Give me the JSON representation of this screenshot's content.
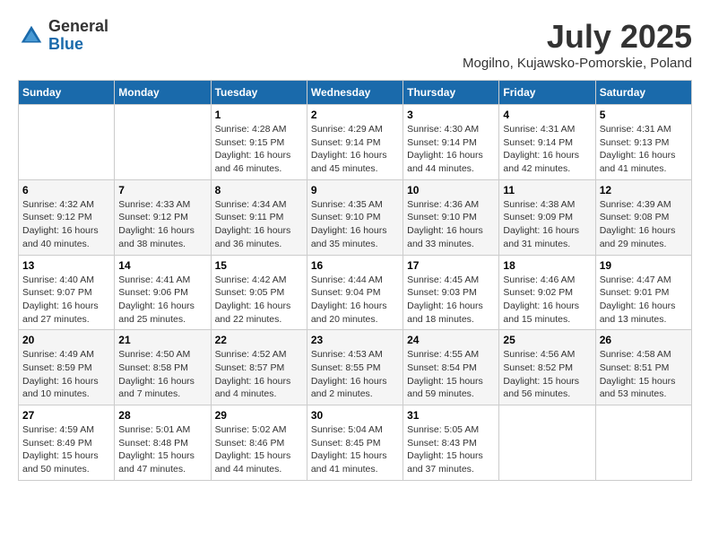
{
  "logo": {
    "general": "General",
    "blue": "Blue"
  },
  "title": "July 2025",
  "subtitle": "Mogilno, Kujawsko-Pomorskie, Poland",
  "days_of_week": [
    "Sunday",
    "Monday",
    "Tuesday",
    "Wednesday",
    "Thursday",
    "Friday",
    "Saturday"
  ],
  "weeks": [
    [
      {
        "day": "",
        "info": ""
      },
      {
        "day": "",
        "info": ""
      },
      {
        "day": "1",
        "info": "Sunrise: 4:28 AM\nSunset: 9:15 PM\nDaylight: 16 hours and 46 minutes."
      },
      {
        "day": "2",
        "info": "Sunrise: 4:29 AM\nSunset: 9:14 PM\nDaylight: 16 hours and 45 minutes."
      },
      {
        "day": "3",
        "info": "Sunrise: 4:30 AM\nSunset: 9:14 PM\nDaylight: 16 hours and 44 minutes."
      },
      {
        "day": "4",
        "info": "Sunrise: 4:31 AM\nSunset: 9:14 PM\nDaylight: 16 hours and 42 minutes."
      },
      {
        "day": "5",
        "info": "Sunrise: 4:31 AM\nSunset: 9:13 PM\nDaylight: 16 hours and 41 minutes."
      }
    ],
    [
      {
        "day": "6",
        "info": "Sunrise: 4:32 AM\nSunset: 9:12 PM\nDaylight: 16 hours and 40 minutes."
      },
      {
        "day": "7",
        "info": "Sunrise: 4:33 AM\nSunset: 9:12 PM\nDaylight: 16 hours and 38 minutes."
      },
      {
        "day": "8",
        "info": "Sunrise: 4:34 AM\nSunset: 9:11 PM\nDaylight: 16 hours and 36 minutes."
      },
      {
        "day": "9",
        "info": "Sunrise: 4:35 AM\nSunset: 9:10 PM\nDaylight: 16 hours and 35 minutes."
      },
      {
        "day": "10",
        "info": "Sunrise: 4:36 AM\nSunset: 9:10 PM\nDaylight: 16 hours and 33 minutes."
      },
      {
        "day": "11",
        "info": "Sunrise: 4:38 AM\nSunset: 9:09 PM\nDaylight: 16 hours and 31 minutes."
      },
      {
        "day": "12",
        "info": "Sunrise: 4:39 AM\nSunset: 9:08 PM\nDaylight: 16 hours and 29 minutes."
      }
    ],
    [
      {
        "day": "13",
        "info": "Sunrise: 4:40 AM\nSunset: 9:07 PM\nDaylight: 16 hours and 27 minutes."
      },
      {
        "day": "14",
        "info": "Sunrise: 4:41 AM\nSunset: 9:06 PM\nDaylight: 16 hours and 25 minutes."
      },
      {
        "day": "15",
        "info": "Sunrise: 4:42 AM\nSunset: 9:05 PM\nDaylight: 16 hours and 22 minutes."
      },
      {
        "day": "16",
        "info": "Sunrise: 4:44 AM\nSunset: 9:04 PM\nDaylight: 16 hours and 20 minutes."
      },
      {
        "day": "17",
        "info": "Sunrise: 4:45 AM\nSunset: 9:03 PM\nDaylight: 16 hours and 18 minutes."
      },
      {
        "day": "18",
        "info": "Sunrise: 4:46 AM\nSunset: 9:02 PM\nDaylight: 16 hours and 15 minutes."
      },
      {
        "day": "19",
        "info": "Sunrise: 4:47 AM\nSunset: 9:01 PM\nDaylight: 16 hours and 13 minutes."
      }
    ],
    [
      {
        "day": "20",
        "info": "Sunrise: 4:49 AM\nSunset: 8:59 PM\nDaylight: 16 hours and 10 minutes."
      },
      {
        "day": "21",
        "info": "Sunrise: 4:50 AM\nSunset: 8:58 PM\nDaylight: 16 hours and 7 minutes."
      },
      {
        "day": "22",
        "info": "Sunrise: 4:52 AM\nSunset: 8:57 PM\nDaylight: 16 hours and 4 minutes."
      },
      {
        "day": "23",
        "info": "Sunrise: 4:53 AM\nSunset: 8:55 PM\nDaylight: 16 hours and 2 minutes."
      },
      {
        "day": "24",
        "info": "Sunrise: 4:55 AM\nSunset: 8:54 PM\nDaylight: 15 hours and 59 minutes."
      },
      {
        "day": "25",
        "info": "Sunrise: 4:56 AM\nSunset: 8:52 PM\nDaylight: 15 hours and 56 minutes."
      },
      {
        "day": "26",
        "info": "Sunrise: 4:58 AM\nSunset: 8:51 PM\nDaylight: 15 hours and 53 minutes."
      }
    ],
    [
      {
        "day": "27",
        "info": "Sunrise: 4:59 AM\nSunset: 8:49 PM\nDaylight: 15 hours and 50 minutes."
      },
      {
        "day": "28",
        "info": "Sunrise: 5:01 AM\nSunset: 8:48 PM\nDaylight: 15 hours and 47 minutes."
      },
      {
        "day": "29",
        "info": "Sunrise: 5:02 AM\nSunset: 8:46 PM\nDaylight: 15 hours and 44 minutes."
      },
      {
        "day": "30",
        "info": "Sunrise: 5:04 AM\nSunset: 8:45 PM\nDaylight: 15 hours and 41 minutes."
      },
      {
        "day": "31",
        "info": "Sunrise: 5:05 AM\nSunset: 8:43 PM\nDaylight: 15 hours and 37 minutes."
      },
      {
        "day": "",
        "info": ""
      },
      {
        "day": "",
        "info": ""
      }
    ]
  ]
}
